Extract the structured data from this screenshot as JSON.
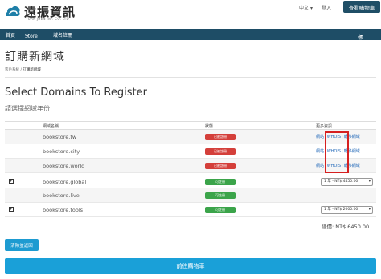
{
  "header": {
    "logo_name": "遠振資訊",
    "logo_sub": "YUAN JHEN INF. CO. LTD",
    "lang": "中文",
    "lang_caret": "▾",
    "login": "登入",
    "cart_button": "查看購物車"
  },
  "nav": {
    "home": "首頁",
    "store": "Store",
    "register": "域名註冊",
    "account": "帳戶",
    "caret": "▾"
  },
  "page": {
    "title": "訂購新網域",
    "breadcrumb": [
      "客戶系統",
      "訂購新網域"
    ],
    "breadcrumb_sep": "/",
    "heading": "Select Domains To Register",
    "subheading": "請選擇網域年份"
  },
  "table": {
    "headers": [
      "網域名稱",
      "狀態",
      "更多資訊"
    ],
    "link_separator": "|",
    "check_mark": "✔",
    "select_caret": "▾",
    "rows": [
      {
        "domain": "bookstore.tw",
        "status": "已被註冊",
        "status_color": "#d43f3a",
        "checked": false,
        "links": [
          "網站",
          "WHOIS",
          "轉移網域"
        ],
        "price": null
      },
      {
        "domain": "bookstore.city",
        "status": "已被註冊",
        "status_color": "#d43f3a",
        "checked": false,
        "links": [
          "網站",
          "WHOIS",
          "轉移網域"
        ],
        "price": null
      },
      {
        "domain": "bookstore.world",
        "status": "已被註冊",
        "status_color": "#d43f3a",
        "checked": false,
        "links": [
          "網站",
          "WHOIS",
          "轉移網域"
        ],
        "price": null
      },
      {
        "domain": "bookstore.global",
        "status": "可註冊",
        "status_color": "#3ba44a",
        "checked": true,
        "links": null,
        "price": "1 年 - NT$ 4450.00"
      },
      {
        "domain": "bookstore.live",
        "status": "可註冊",
        "status_color": "#3ba44a",
        "checked": false,
        "links": null,
        "price": null
      },
      {
        "domain": "bookstore.tools",
        "status": "可註冊",
        "status_color": "#3ba44a",
        "checked": true,
        "links": null,
        "price": "1 年 - NT$ 2000.00"
      }
    ]
  },
  "summary": {
    "total": "總價: NT$ 6450.00"
  },
  "actions": {
    "clear": "清除並返回",
    "checkout": "前往購物車"
  },
  "colors": {
    "navbar": "#1e4d66",
    "primary_button": "#1aa0d8",
    "highlight": "#d62020"
  }
}
